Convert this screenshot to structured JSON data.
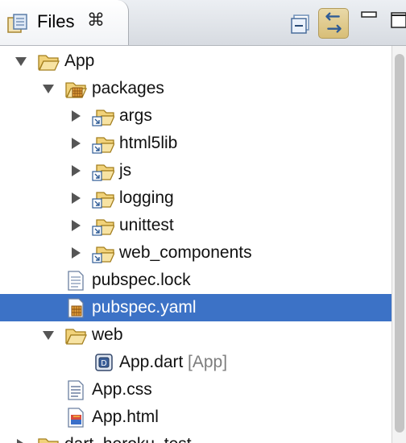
{
  "view": {
    "tab_label": "Files",
    "tab_close_glyph": "⌘",
    "toolbar": {
      "collapse_all_icon": "collapse-all-icon",
      "link_with_editor_icon": "link-with-editor-icon",
      "minimize_icon": "minimize-icon",
      "maximize_icon": "maximize-icon"
    }
  },
  "tree": {
    "rows": [
      {
        "label": "App",
        "suffix": "",
        "icon": "open-folder-icon",
        "twisty": "expanded"
      },
      {
        "label": "packages",
        "suffix": "",
        "icon": "packages-folder-icon",
        "twisty": "expanded"
      },
      {
        "label": "args",
        "suffix": "",
        "icon": "linked-folder-icon",
        "twisty": "collapsed"
      },
      {
        "label": "html5lib",
        "suffix": "",
        "icon": "linked-folder-icon",
        "twisty": "collapsed"
      },
      {
        "label": "js",
        "suffix": "",
        "icon": "linked-folder-icon",
        "twisty": "collapsed"
      },
      {
        "label": "logging",
        "suffix": "",
        "icon": "linked-folder-icon",
        "twisty": "collapsed"
      },
      {
        "label": "unittest",
        "suffix": "",
        "icon": "linked-folder-icon",
        "twisty": "collapsed"
      },
      {
        "label": "web_components",
        "suffix": "",
        "icon": "linked-folder-icon",
        "twisty": "collapsed"
      },
      {
        "label": "pubspec.lock",
        "suffix": "",
        "icon": "text-file-icon",
        "twisty": "none"
      },
      {
        "label": "pubspec.yaml",
        "suffix": "",
        "icon": "yaml-file-icon",
        "twisty": "none",
        "selected": true
      },
      {
        "label": "web",
        "suffix": "",
        "icon": "open-folder-icon",
        "twisty": "expanded"
      },
      {
        "label": "App.dart",
        "suffix": "[App]",
        "icon": "dart-file-icon",
        "twisty": "none"
      },
      {
        "label": "App.css",
        "suffix": "",
        "icon": "css-file-icon",
        "twisty": "none"
      },
      {
        "label": "App.html",
        "suffix": "",
        "icon": "html-file-icon",
        "twisty": "none"
      },
      {
        "label": "dart_heroku_test",
        "suffix": "",
        "icon": "closed-folder-icon",
        "twisty": "collapsed"
      }
    ]
  },
  "colors": {
    "selection": "#3c72c6",
    "folder": "#e9b94a",
    "muted_text": "#7d7d7d"
  }
}
